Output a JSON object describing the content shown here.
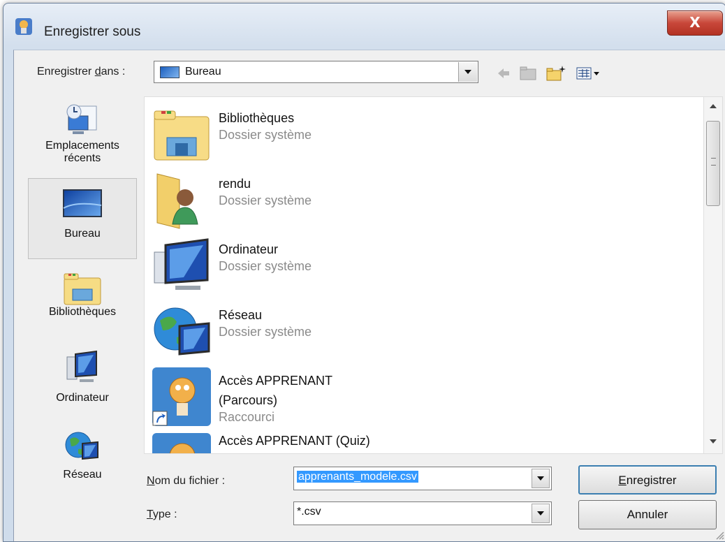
{
  "window": {
    "title": "Enregistrer sous",
    "close_label": "X"
  },
  "toolbar": {
    "save_in_label_prefix": "Enregistrer ",
    "save_in_label_access": "d",
    "save_in_label_suffix": "ans :",
    "location": "Bureau",
    "icons": [
      "back-arrow-icon",
      "up-folder-icon",
      "new-folder-icon",
      "view-menu-icon"
    ]
  },
  "places": [
    {
      "label_line1": "Emplacements",
      "label_line2": "récents",
      "icon": "recent-places-icon"
    },
    {
      "label_line1": "Bureau",
      "label_line2": "",
      "icon": "desktop-icon",
      "selected": true
    },
    {
      "label_line1": "Bibliothèques",
      "label_line2": "",
      "icon": "libraries-icon"
    },
    {
      "label_line1": "Ordinateur",
      "label_line2": "",
      "icon": "computer-icon"
    },
    {
      "label_line1": "Réseau",
      "label_line2": "",
      "icon": "network-icon"
    }
  ],
  "files": [
    {
      "name": "Bibliothèques",
      "name2": "",
      "type": "Dossier système",
      "icon": "libraries-folder-icon"
    },
    {
      "name": "rendu",
      "name2": "",
      "type": "Dossier système",
      "icon": "user-folder-icon"
    },
    {
      "name": "Ordinateur",
      "name2": "",
      "type": "Dossier système",
      "icon": "computer-icon"
    },
    {
      "name": "Réseau",
      "name2": "",
      "type": "Dossier système",
      "icon": "network-globe-icon"
    },
    {
      "name": "Accès APPRENANT",
      "name2": "(Parcours)",
      "type": "Raccourci",
      "icon": "shortcut-app-icon"
    },
    {
      "name": "Accès APPRENANT (Quiz)",
      "name2": "",
      "type": "",
      "icon": "shortcut-app-icon"
    }
  ],
  "filename": {
    "label_access": "N",
    "label_rest": "om du fichier :",
    "value": "apprenants_modele.csv"
  },
  "filetype": {
    "label_access": "T",
    "label_rest": "ype :",
    "value": "*.csv"
  },
  "buttons": {
    "save_access": "E",
    "save_rest": "nregistrer",
    "cancel": "Annuler"
  },
  "colors": {
    "selection": "#3399ff",
    "close_button": "#c8473a",
    "frame": "#d3dfed"
  }
}
